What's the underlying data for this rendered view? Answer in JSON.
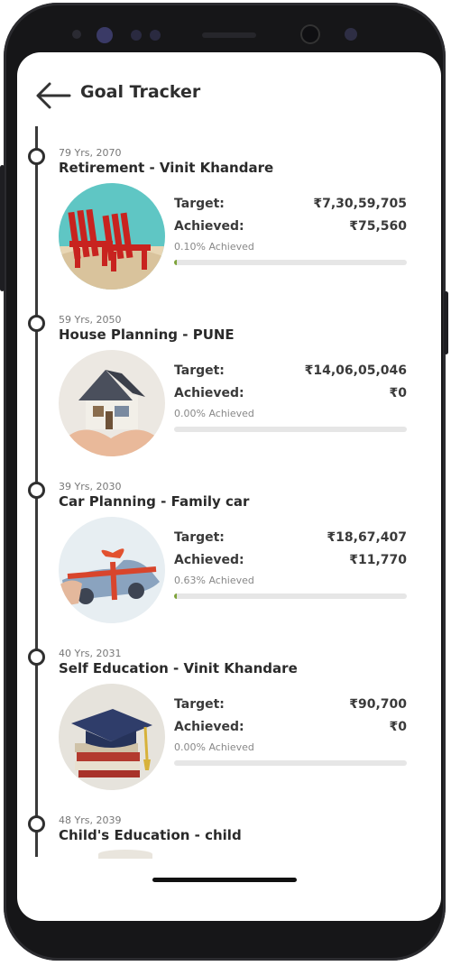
{
  "header": {
    "title": "Goal Tracker",
    "back_icon": "arrow-left-icon"
  },
  "labels": {
    "target": "Target:",
    "achieved": "Achieved:"
  },
  "goals": [
    {
      "meta": "79 Yrs, 2070",
      "name": "Retirement - Vinit Khandare",
      "target": "₹7,30,59,705",
      "achieved": "₹75,560",
      "pct_text": "0.10% Achieved",
      "progress": 0.001,
      "image": "beach-chairs"
    },
    {
      "meta": "59 Yrs, 2050",
      "name": "House Planning - PUNE",
      "target": "₹14,06,05,046",
      "achieved": "₹0",
      "pct_text": "0.00% Achieved",
      "progress": 0.0,
      "image": "house"
    },
    {
      "meta": "39 Yrs, 2030",
      "name": "Car Planning - Family car",
      "target": "₹18,67,407",
      "achieved": "₹11,770",
      "pct_text": "0.63% Achieved",
      "progress": 0.0063,
      "image": "gift-car"
    },
    {
      "meta": "40 Yrs, 2031",
      "name": "Self Education - Vinit Khandare",
      "target": "₹90,700",
      "achieved": "₹0",
      "pct_text": "0.00% Achieved",
      "progress": 0.0,
      "image": "graduation-cap"
    },
    {
      "meta": "48 Yrs, 2039",
      "name": "Child's Education - child"
    }
  ],
  "colors": {
    "progress_fill": "#7ea33a",
    "progress_track": "#e6e6e6",
    "timeline": "#3a3a3a"
  }
}
